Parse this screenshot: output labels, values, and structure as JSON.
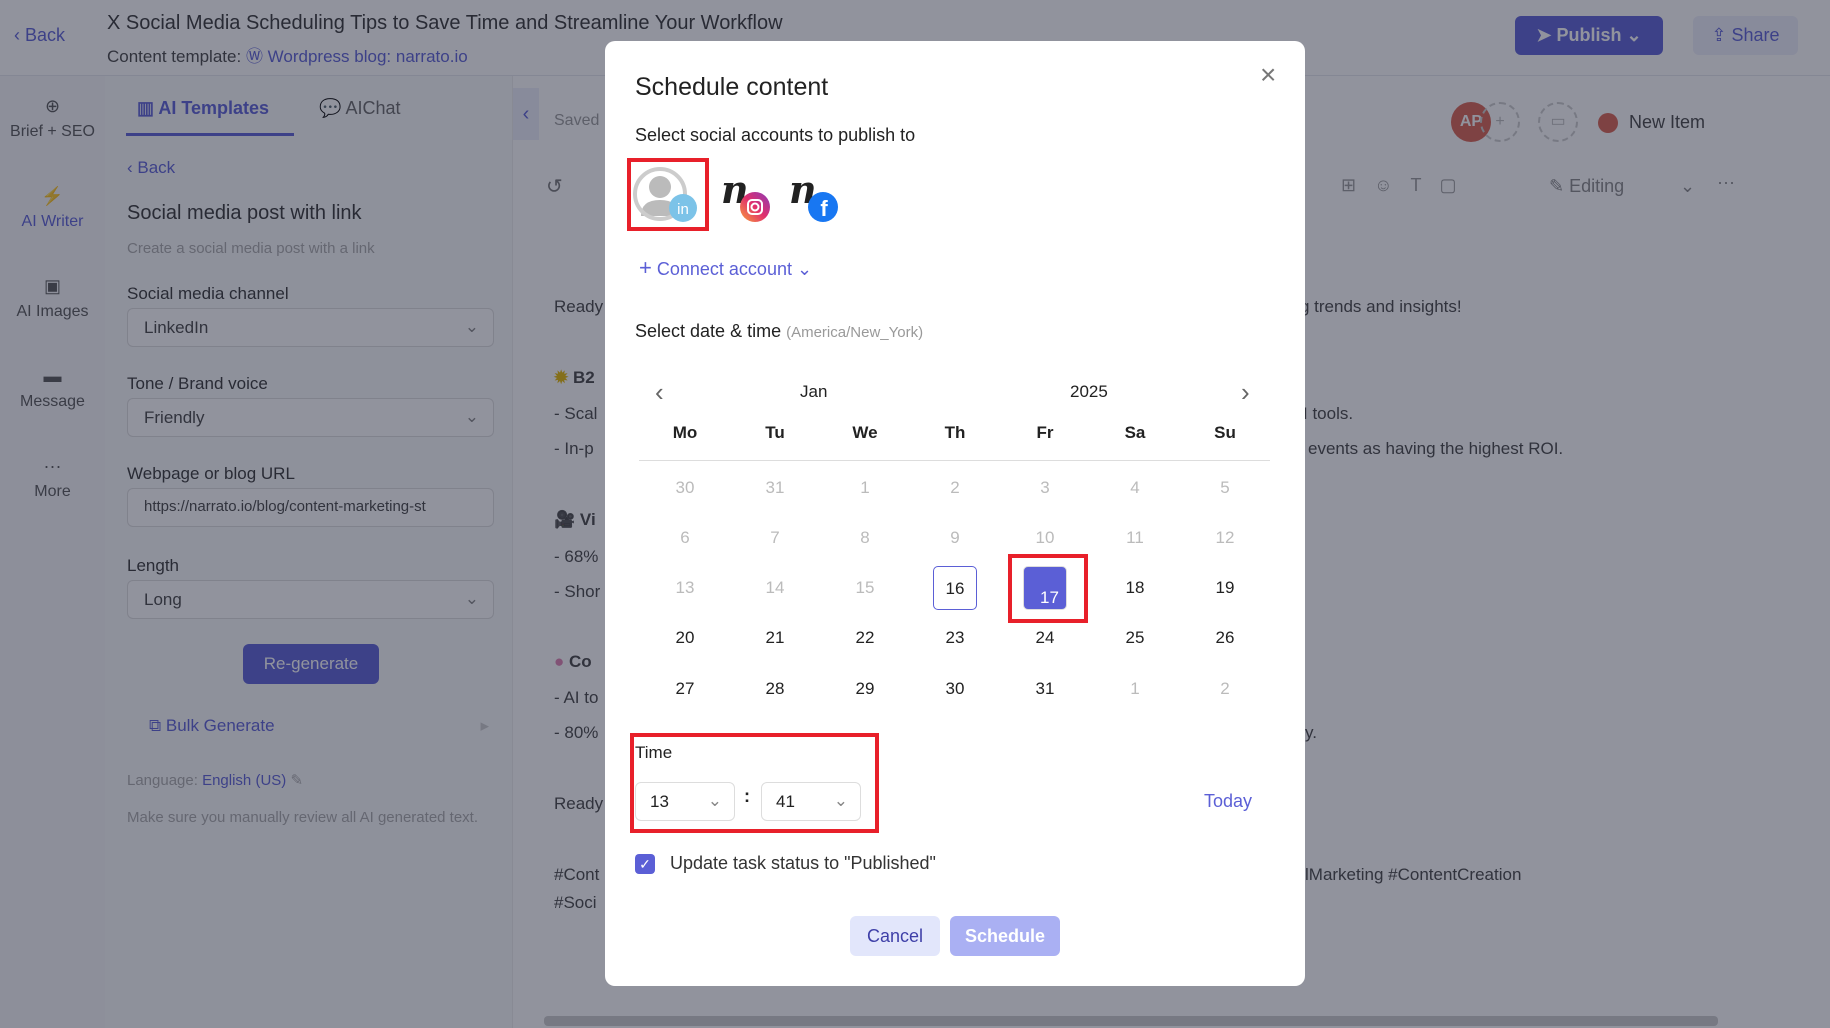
{
  "header": {
    "back": "Back",
    "title": "X Social Media Scheduling Tips to Save Time and Streamline Your Workflow",
    "template_label": "Content template:",
    "template_value": "Wordpress blog: narrato.io",
    "publish": "Publish",
    "share": "Share"
  },
  "rail": [
    {
      "icon": "target-icon",
      "label": "Brief + SEO"
    },
    {
      "icon": "bolt-icon",
      "label": "AI Writer"
    },
    {
      "icon": "image-icon",
      "label": "AI Images"
    },
    {
      "icon": "message-icon",
      "label": "Message"
    },
    {
      "icon": "more-icon",
      "label": "More"
    }
  ],
  "panel": {
    "tabs": [
      "AI Templates",
      "AIChat"
    ],
    "back": "Back",
    "title": "Social media post with link",
    "subtitle": "Create a social media post with a link",
    "fields": [
      {
        "label": "Social media channel",
        "value": "LinkedIn"
      },
      {
        "label": "Tone / Brand voice",
        "value": "Friendly"
      },
      {
        "label": "Webpage or blog URL",
        "value": "https://narrato.io/blog/content-marketing-st"
      },
      {
        "label": "Length",
        "value": "Long"
      }
    ],
    "regenerate": "Re-generate",
    "bulk": "Bulk Generate",
    "language_label": "Language:",
    "language": "English (US)",
    "disclaimer": "Make sure you manually review all AI generated text."
  },
  "editor": {
    "saved": "Saved",
    "avatar": "AP",
    "status": "New Item",
    "mode": "Editing",
    "left_fragments": [
      "Ready",
      "B2",
      "- Scal",
      "- In-p",
      "Vi",
      "- 68%",
      "- Shor",
      "Co",
      "- AI to",
      "- 80%",
      "Ready",
      "#Cont",
      "#Soci"
    ],
    "right_fragments": [
      "g trends and insights!",
      "I tools.",
      "events as having the highest ROI.",
      "y.",
      "lMarketing #ContentCreation"
    ]
  },
  "modal": {
    "title": "Schedule content",
    "accounts_label": "Select social accounts to publish to",
    "accounts": [
      {
        "network": "linkedin",
        "selected": true
      },
      {
        "network": "instagram",
        "selected": false
      },
      {
        "network": "facebook",
        "selected": false
      }
    ],
    "connect": "Connect account",
    "date_label": "Select date & time",
    "timezone": "(America/New_York)",
    "month": "Jan",
    "year": "2025",
    "weekdays": [
      "Mo",
      "Tu",
      "We",
      "Th",
      "Fr",
      "Sa",
      "Su"
    ],
    "days": [
      [
        "30",
        "31",
        "1",
        "2",
        "3",
        "4",
        "5"
      ],
      [
        "6",
        "7",
        "8",
        "9",
        "10",
        "11",
        "12"
      ],
      [
        "13",
        "14",
        "15",
        "16",
        "17",
        "18",
        "19"
      ],
      [
        "20",
        "21",
        "22",
        "23",
        "24",
        "25",
        "26"
      ],
      [
        "27",
        "28",
        "29",
        "30",
        "31",
        "1",
        "2"
      ]
    ],
    "today_day": "16",
    "selected_day": "17",
    "time_label": "Time",
    "hour": "13",
    "minute": "41",
    "today": "Today",
    "checkbox_label": "Update task status to \"Published\"",
    "checkbox_checked": true,
    "cancel": "Cancel",
    "schedule": "Schedule"
  },
  "colors": {
    "accent": "#5b5fd6",
    "highlight": "#e8202a"
  }
}
